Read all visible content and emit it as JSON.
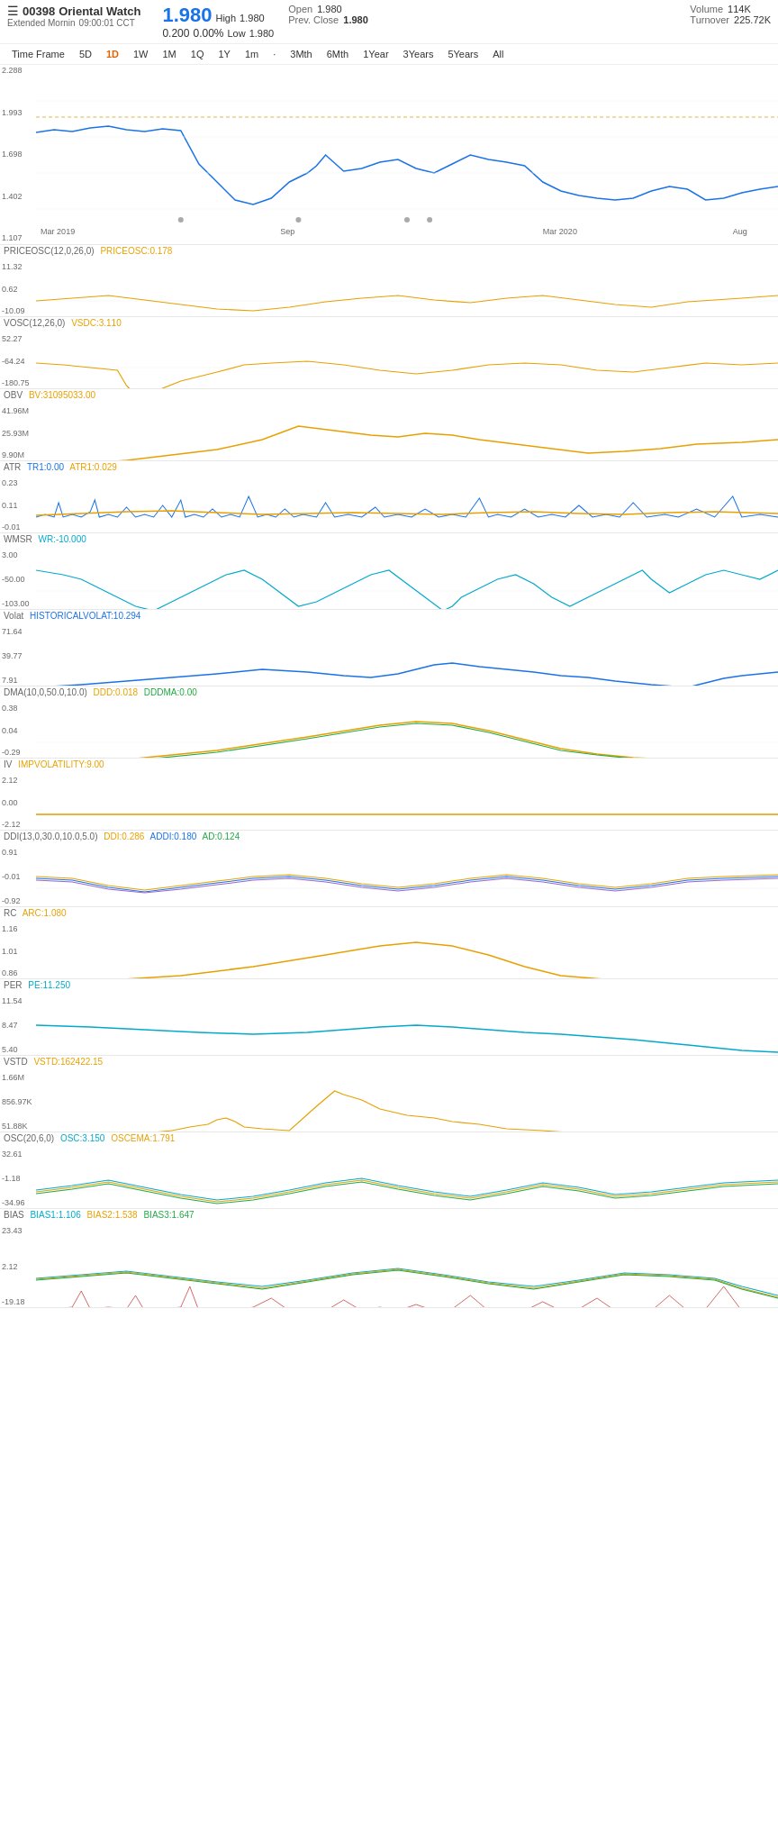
{
  "header": {
    "stock_code": "00398",
    "stock_name": "Oriental Watch",
    "extended_label": "Extended Mornin",
    "time": "09:00:01 CCT",
    "price": "1.980",
    "change": "0.200",
    "change_pct": "0.00%",
    "high_label": "High",
    "high_val": "1.980",
    "low_label": "Low",
    "low_val": "1.980",
    "open_label": "Open",
    "open_val": "1.980",
    "prev_close_label": "Prev. Close",
    "prev_close_val": "1.980",
    "volume_label": "Volume",
    "volume_val": "114K",
    "turnover_label": "Turnover",
    "turnover_val": "225.72K"
  },
  "timeframe": {
    "buttons": [
      "Time Frame",
      "5D",
      "1D",
      "1W",
      "1M",
      "1Q",
      "1Y",
      "1m",
      "·",
      "3Mth",
      "6Mth",
      "1Year",
      "3Years",
      "5Years",
      "All"
    ],
    "active": "1D"
  },
  "charts": {
    "main": {
      "y_labels": [
        "2.288",
        "1.993",
        "1.698",
        "1.402",
        "1.107"
      ],
      "x_labels": [
        "Mar 2019",
        "Sep",
        "Mar 2020",
        "Aug"
      ]
    },
    "priceosc": {
      "label": "PRICEOSC(12,0,26,0)",
      "value_label": "PRICEOSC:0.178",
      "y_labels": [
        "11.32",
        "0.62",
        "-10.09"
      ]
    },
    "vosc": {
      "label": "VOSC(12,26,0)",
      "value_label": "VSDC:3.110",
      "y_labels": [
        "52.27",
        "-64.24",
        "-180.75"
      ]
    },
    "obv": {
      "label": "OBV",
      "value_label": "BV:31095033.00",
      "y_labels": [
        "41.96M",
        "25.93M",
        "9.90M"
      ]
    },
    "atr": {
      "label": "ATR",
      "value_label1": "TR1:0.00",
      "value_label2": "ATR1:0.029",
      "y_labels": [
        "0.23",
        "0.11",
        "-0.01"
      ]
    },
    "wmsr": {
      "label": "WMSR",
      "value_label": "WR:-10.000",
      "y_labels": [
        "3.00",
        "-50.00",
        "-103.00"
      ]
    },
    "volat": {
      "label": "Volat",
      "value_label": "HISTORICALVOLAT:10.294",
      "y_labels": [
        "71.64",
        "39.77",
        "7.91"
      ]
    },
    "dma": {
      "label": "DMA(10,0,50.0,10.0)",
      "value_label1": "DDD:0.018",
      "value_label2": "DDDMA:0.00",
      "y_labels": [
        "0.38",
        "0.04",
        "-0.29"
      ]
    },
    "iv": {
      "label": "IV",
      "value_label": "IMPVOLATILITY:9.00",
      "y_labels": [
        "2.12",
        "0.00",
        "-2.12"
      ]
    },
    "ddi": {
      "label": "DDI(13,0,30.0,10.0,5.0)",
      "value_label1": "DDI:0.286",
      "value_label2": "ADDI:0.180",
      "value_label3": "AD:0.124",
      "y_labels": [
        "0.91",
        "-0.01",
        "-0.92"
      ]
    },
    "rc": {
      "label": "RC",
      "value_label": "ARC:1.080",
      "y_labels": [
        "1.16",
        "1.01",
        "0.86"
      ]
    },
    "per": {
      "label": "PER",
      "value_label": "PE:11.250",
      "y_labels": [
        "11.54",
        "8.47",
        "5.40"
      ]
    },
    "vstd": {
      "label": "VSTD",
      "value_label": "VSTD:162422.15",
      "y_labels": [
        "1.66M",
        "856.97K",
        "51.88K"
      ]
    },
    "osc": {
      "label": "OSC(20,6,0)",
      "value_label1": "OSC:3.150",
      "value_label2": "OSCEMA:1.791",
      "y_labels": [
        "32.61",
        "-1.18",
        "-34.96"
      ]
    },
    "bias": {
      "label": "BIAS",
      "value_label1": "BIAS1:1.106",
      "value_label2": "BIAS2:1.538",
      "value_label3": "BIAS3:1.647",
      "y_labels": [
        "23.43",
        "2.12",
        "-19.18"
      ]
    }
  }
}
